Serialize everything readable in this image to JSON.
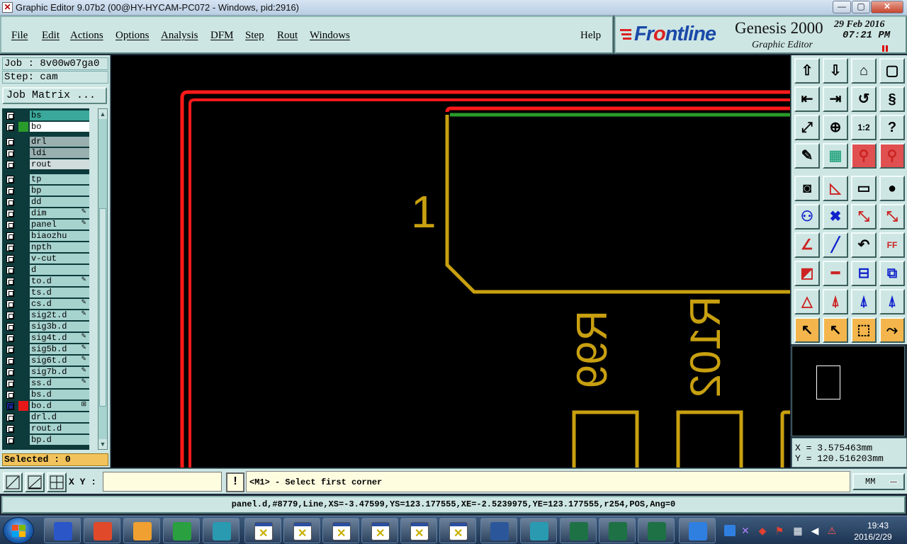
{
  "window": {
    "title": "Graphic Editor 9.07b2 (00@HY-HYCAM-PC072 - Windows, pid:2916)",
    "controls": {
      "minimize": "—",
      "maximize": "▢",
      "close": "✕"
    }
  },
  "menu": {
    "items": [
      {
        "label": "File"
      },
      {
        "label": "Edit"
      },
      {
        "label": "Actions"
      },
      {
        "label": "Options"
      },
      {
        "label": "Analysis"
      },
      {
        "label": "DFM"
      },
      {
        "label": "Step"
      },
      {
        "label": "Rout"
      },
      {
        "label": "Windows"
      }
    ],
    "help": "Help"
  },
  "brand": {
    "logo_pre": "Fr",
    "logo_o": "o",
    "logo_post": "ntline",
    "product": "Genesis 2000",
    "subtitle": "Graphic Editor",
    "date": "29 Feb 2016",
    "time": "07:21 PM"
  },
  "job": {
    "job_label": "Job : 8v00w07ga0",
    "step_label": "Step: cam",
    "matrix_button": "Job Matrix ...",
    "selected": "Selected : 0"
  },
  "layers": [
    {
      "name": "bs",
      "swatch": "",
      "bg": "#3aa89a"
    },
    {
      "name": "bo",
      "swatch": "#2a9a2a",
      "bg": "#ffffff"
    },
    {
      "name": "drl",
      "swatch": "",
      "bg": "#9ab0b0",
      "gap": true
    },
    {
      "name": "ldi",
      "swatch": "",
      "bg": "#9ab0b0"
    },
    {
      "name": "rout",
      "swatch": "",
      "bg": "#d0dcdc"
    },
    {
      "name": "tp",
      "swatch": "",
      "bg": "#a7d3cf",
      "gap": true
    },
    {
      "name": "bp",
      "swatch": "",
      "bg": "#a7d3cf"
    },
    {
      "name": "dd",
      "swatch": "",
      "bg": "#a7d3cf"
    },
    {
      "name": "dim",
      "swatch": "",
      "bg": "#a7d3cf",
      "mark": "✎"
    },
    {
      "name": "panel",
      "swatch": "",
      "bg": "#a7d3cf",
      "mark": "✎"
    },
    {
      "name": "biaozhu",
      "swatch": "",
      "bg": "#a7d3cf"
    },
    {
      "name": "npth",
      "swatch": "",
      "bg": "#a7d3cf"
    },
    {
      "name": "v-cut",
      "swatch": "",
      "bg": "#a7d3cf"
    },
    {
      "name": "d",
      "swatch": "",
      "bg": "#a7d3cf"
    },
    {
      "name": "to.d",
      "swatch": "",
      "bg": "#a7d3cf",
      "mark": "✎"
    },
    {
      "name": "ts.d",
      "swatch": "",
      "bg": "#a7d3cf"
    },
    {
      "name": "cs.d",
      "swatch": "",
      "bg": "#a7d3cf",
      "mark": "✎"
    },
    {
      "name": "sig2t.d",
      "swatch": "",
      "bg": "#a7d3cf",
      "mark": "✎"
    },
    {
      "name": "sig3b.d",
      "swatch": "",
      "bg": "#a7d3cf"
    },
    {
      "name": "sig4t.d",
      "swatch": "",
      "bg": "#a7d3cf",
      "mark": "✎"
    },
    {
      "name": "sig5b.d",
      "swatch": "",
      "bg": "#a7d3cf",
      "mark": "✎"
    },
    {
      "name": "sig6t.d",
      "swatch": "",
      "bg": "#a7d3cf",
      "mark": "✎"
    },
    {
      "name": "sig7b.d",
      "swatch": "",
      "bg": "#a7d3cf",
      "mark": "✎"
    },
    {
      "name": "ss.d",
      "swatch": "",
      "bg": "#a7d3cf",
      "mark": "✎"
    },
    {
      "name": "bs.d",
      "swatch": "",
      "bg": "#a7d3cf"
    },
    {
      "name": "bo.d",
      "swatch": "#e81818",
      "bg": "#a7d3cf",
      "mark": "⊞",
      "chk_selected": true
    },
    {
      "name": "drl.d",
      "swatch": "",
      "bg": "#a7d3cf"
    },
    {
      "name": "rout.d",
      "swatch": "",
      "bg": "#a7d3cf"
    },
    {
      "name": "bp.d",
      "swatch": "",
      "bg": "#a7d3cf"
    }
  ],
  "canvas": {
    "label_1": "1",
    "label_r99": "R99",
    "label_r102": "R102",
    "colors": {
      "panel_outline": "#ff1a1a",
      "green_line": "#2a9a2a",
      "silkscreen": "#c8a010"
    }
  },
  "coords": {
    "x": "X = 3.575463mm",
    "y": "Y = 120.516203mm"
  },
  "command": {
    "xy_label": "X Y :",
    "xy_value": "",
    "warn": "!",
    "prompt": "<M1> - Select first corner",
    "units": "MM"
  },
  "status": {
    "text": "panel.d,#8779,Line,XS=-3.47599,YS=123.177555,XE=-2.5239975,YE=123.177555,r254,POS,Ang=0"
  },
  "taskbar": {
    "clock_time": "19:43",
    "clock_date": "2016/2/29"
  }
}
